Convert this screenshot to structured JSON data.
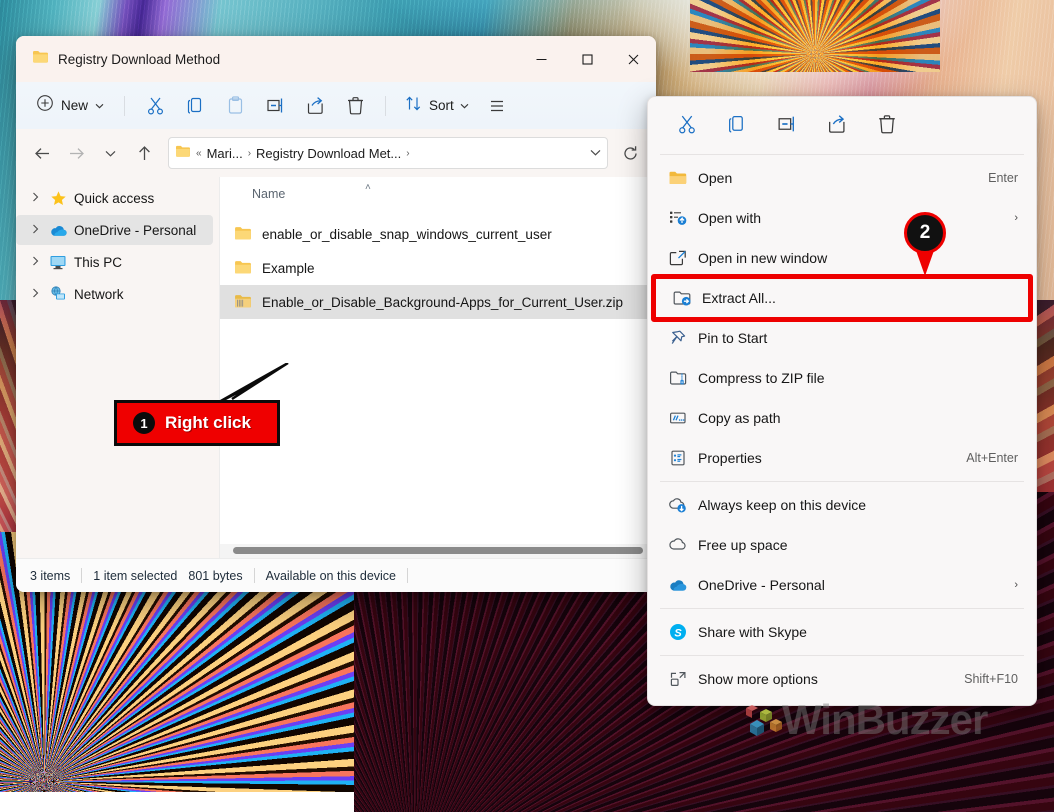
{
  "window": {
    "title": "Registry Download Method",
    "icon": "folder-icon",
    "controls": {
      "minimize": "—",
      "maximize": "☐",
      "close": "✕"
    }
  },
  "toolbar": {
    "new_label": "New",
    "new_icon": "plus-circle-icon",
    "buttons": [
      {
        "name": "cut",
        "icon": "scissors-icon"
      },
      {
        "name": "copy",
        "icon": "copy-icon"
      },
      {
        "name": "paste",
        "icon": "paste-icon"
      },
      {
        "name": "rename",
        "icon": "rename-icon"
      },
      {
        "name": "share",
        "icon": "share-icon"
      },
      {
        "name": "delete",
        "icon": "trash-icon"
      }
    ],
    "sort_label": "Sort",
    "sort_icon": "sort-arrows-icon",
    "view_icon": "view-list-icon",
    "chevron": "⌄"
  },
  "addressbar": {
    "back_icon": "arrow-left-icon",
    "forward_icon": "arrow-right-icon",
    "recent_icon": "chevron-down-icon",
    "up_icon": "arrow-up-icon",
    "folder_icon": "folder-icon",
    "overflow": "«",
    "crumbs": [
      "Mari...",
      "Registry Download Met..."
    ],
    "separator": "›",
    "dropdown": "⌄",
    "refresh_icon": "refresh-icon"
  },
  "sidebar": {
    "items": [
      {
        "label": "Quick access",
        "icon": "star-icon",
        "selected": false
      },
      {
        "label": "OneDrive - Personal",
        "icon": "onedrive-icon",
        "selected": true
      },
      {
        "label": "This PC",
        "icon": "monitor-icon",
        "selected": false
      },
      {
        "label": "Network",
        "icon": "network-icon",
        "selected": false
      }
    ],
    "expander": "›"
  },
  "filepane": {
    "column_header": "Name",
    "sort_caret": "˄",
    "rows": [
      {
        "name": "enable_or_disable_snap_windows_current_user",
        "icon": "folder-icon",
        "selected": false
      },
      {
        "name": "Example",
        "icon": "folder-icon",
        "selected": false
      },
      {
        "name": "Enable_or_Disable_Background-Apps_for_Current_User.zip",
        "icon": "zip-folder-icon",
        "selected": true
      }
    ]
  },
  "statusbar": {
    "item_count": "3 items",
    "selection": "1 item selected",
    "size": "801 bytes",
    "availability": "Available on this device"
  },
  "context_menu": {
    "quick_actions": [
      {
        "name": "cut",
        "icon": "scissors-icon"
      },
      {
        "name": "copy",
        "icon": "copy-icon"
      },
      {
        "name": "rename",
        "icon": "rename-icon"
      },
      {
        "name": "share",
        "icon": "share-icon"
      },
      {
        "name": "delete",
        "icon": "trash-icon"
      }
    ],
    "items": [
      {
        "label": "Open",
        "icon": "folder-open-icon",
        "accel": "Enter",
        "submenu": false,
        "highlighted": false
      },
      {
        "label": "Open with",
        "icon": "open-with-icon",
        "accel": "",
        "submenu": true,
        "highlighted": false
      },
      {
        "label": "Open in new window",
        "icon": "new-window-icon",
        "accel": "",
        "submenu": false,
        "highlighted": false
      },
      {
        "label": "Extract All...",
        "icon": "extract-all-icon",
        "accel": "",
        "submenu": false,
        "highlighted": true
      },
      {
        "label": "Pin to Start",
        "icon": "pin-icon",
        "accel": "",
        "submenu": false,
        "highlighted": false
      },
      {
        "label": "Compress to ZIP file",
        "icon": "compress-zip-icon",
        "accel": "",
        "submenu": false,
        "highlighted": false
      },
      {
        "label": "Copy as path",
        "icon": "copy-path-icon",
        "accel": "",
        "submenu": false,
        "highlighted": false
      },
      {
        "label": "Properties",
        "icon": "properties-icon",
        "accel": "Alt+Enter",
        "submenu": false,
        "highlighted": false
      }
    ],
    "items_cloud": [
      {
        "label": "Always keep on this device",
        "icon": "cloud-download-icon",
        "accel": "",
        "submenu": false
      },
      {
        "label": "Free up space",
        "icon": "cloud-outline-icon",
        "accel": "",
        "submenu": false
      },
      {
        "label": "OneDrive - Personal",
        "icon": "onedrive-icon",
        "accel": "",
        "submenu": true
      }
    ],
    "items_share": [
      {
        "label": "Share with Skype",
        "icon": "skype-icon",
        "accel": "",
        "submenu": false
      }
    ],
    "items_more": [
      {
        "label": "Show more options",
        "icon": "show-more-icon",
        "accel": "Shift+F10",
        "submenu": false
      }
    ],
    "submenu_arrow": "›"
  },
  "annotations": {
    "step1": {
      "number": "1",
      "text": "Right click"
    },
    "step2": {
      "number": "2"
    },
    "highlight_color": "#ee0000"
  },
  "watermark": {
    "text": "WinBuzzer"
  }
}
